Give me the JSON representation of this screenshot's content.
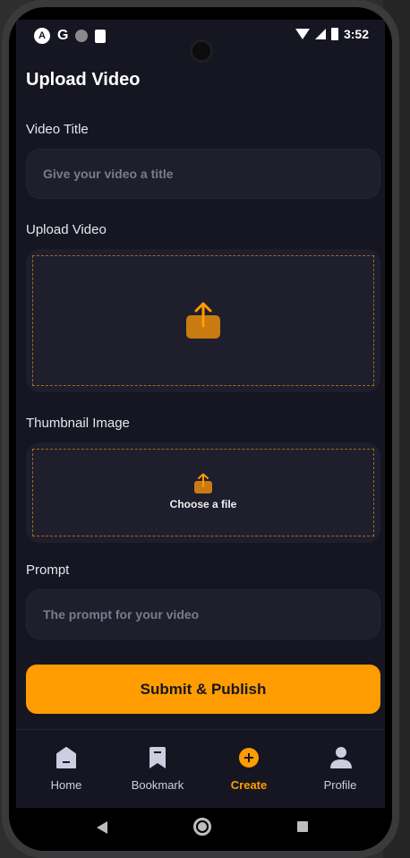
{
  "status_bar": {
    "time": "3:52",
    "icons": [
      "app-badge-icon",
      "google-icon",
      "dot-icon",
      "sd-card-icon",
      "wifi-icon",
      "signal-icon",
      "battery-icon"
    ]
  },
  "page": {
    "title": "Upload Video"
  },
  "form": {
    "video_title": {
      "label": "Video Title",
      "placeholder": "Give your video a title"
    },
    "upload_video": {
      "label": "Upload Video"
    },
    "thumbnail": {
      "label": "Thumbnail Image",
      "choose_text": "Choose a file"
    },
    "prompt": {
      "label": "Prompt",
      "placeholder": "The prompt for your video"
    },
    "submit_label": "Submit & Publish"
  },
  "tabs": [
    {
      "label": "Home",
      "icon": "home-icon"
    },
    {
      "label": "Bookmark",
      "icon": "bookmark-icon"
    },
    {
      "label": "Create",
      "icon": "plus-circle-icon",
      "active": true
    },
    {
      "label": "Profile",
      "icon": "profile-icon"
    }
  ],
  "colors": {
    "background": "#161622",
    "field": "#1e1e2d",
    "accent": "#ff9c01",
    "upload_icon": "#c97a10"
  }
}
